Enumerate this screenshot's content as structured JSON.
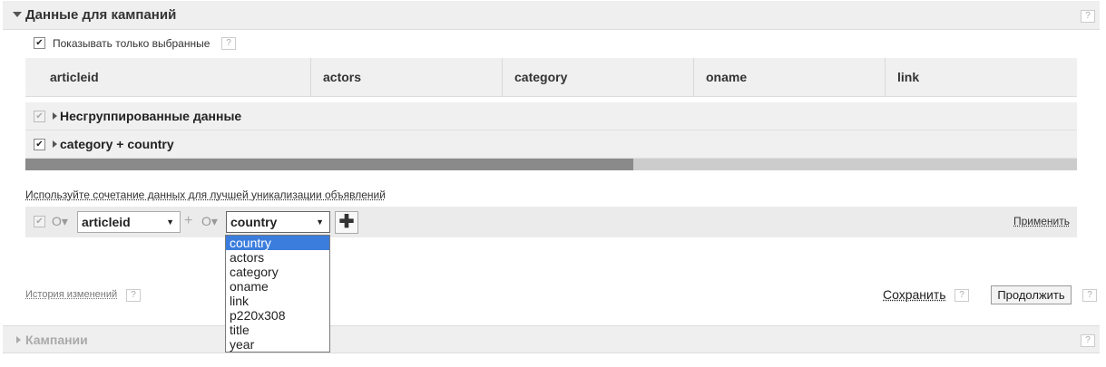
{
  "section": {
    "title": "Данные для кампаний"
  },
  "show_selected": {
    "label": "Показывать только выбранные",
    "checked": true
  },
  "table": {
    "headers": [
      "articleid",
      "actors",
      "category",
      "oname",
      "link"
    ]
  },
  "groups": [
    {
      "label": "Несгруппированные данные",
      "checked": true,
      "disabled": true
    },
    {
      "label": "category + country",
      "checked": true,
      "disabled": false
    }
  ],
  "combo": {
    "hint": "Используйте сочетание данных для лучшей уникализации объявлений",
    "plus_sign": "+",
    "first_select": {
      "value": "articleid"
    },
    "second_select": {
      "value": "country",
      "options": [
        "country",
        "actors",
        "category",
        "oname",
        "link",
        "p220x308",
        "title",
        "year"
      ]
    },
    "apply_label": "Применить"
  },
  "footer": {
    "history_label": "История изменений",
    "save_label": "Сохранить",
    "continue_label": "Продолжить"
  },
  "campaigns": {
    "title": "Кампании"
  },
  "help_mark": "?",
  "icons": {
    "add": "plus-icon",
    "check": "check-icon"
  }
}
